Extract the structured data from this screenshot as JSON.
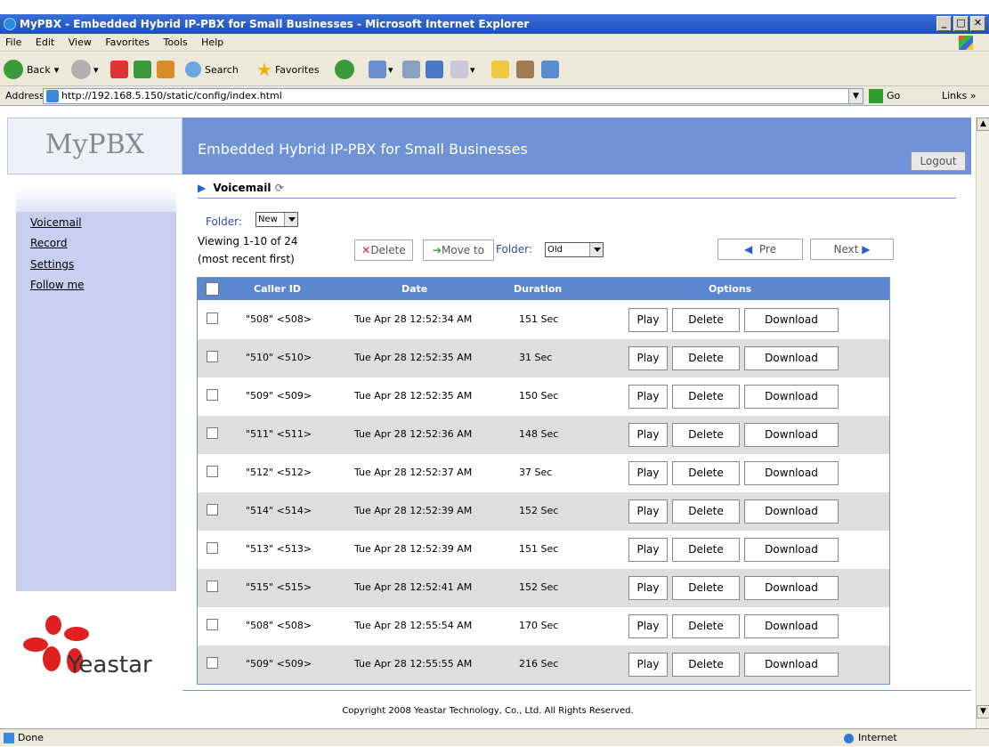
{
  "window": {
    "title": "MyPBX - Embedded Hybrid IP-PBX for Small Businesses - Microsoft Internet Explorer"
  },
  "menu": [
    "File",
    "Edit",
    "View",
    "Favorites",
    "Tools",
    "Help"
  ],
  "toolbar": {
    "back": "Back",
    "search": "Search",
    "favorites": "Favorites"
  },
  "address": {
    "label": "Address",
    "url": "http://192.168.5.150/static/config/index.html",
    "go": "Go",
    "links": "Links"
  },
  "header": {
    "logo": "MyPBX",
    "title": "Embedded Hybrid IP-PBX for Small Businesses",
    "logout": "Logout"
  },
  "sidebar": {
    "items": [
      "Voicemail",
      "Record",
      "Settings",
      "Follow me"
    ],
    "brand": "Yeastar"
  },
  "page": {
    "breadcrumb": "Voicemail",
    "folder_label": "Folder:",
    "folder_value": "New",
    "viewing": "Viewing 1-10 of 24",
    "order": "(most recent first)",
    "delete_btn": "Delete",
    "move_btn": "Move to",
    "move_folder_label": "Folder:",
    "move_folder_value": "Old",
    "pre": "Pre",
    "next": "Next"
  },
  "table": {
    "headers": [
      "Caller ID",
      "Date",
      "Duration",
      "Options"
    ],
    "option_labels": [
      "Play",
      "Delete",
      "Download"
    ],
    "rows": [
      {
        "caller": "\"508\" <508>",
        "date": "Tue Apr 28 12:52:34 AM",
        "duration": "151 Sec"
      },
      {
        "caller": "\"510\" <510>",
        "date": "Tue Apr 28 12:52:35 AM",
        "duration": "31 Sec"
      },
      {
        "caller": "\"509\" <509>",
        "date": "Tue Apr 28 12:52:35 AM",
        "duration": "150 Sec"
      },
      {
        "caller": "\"511\" <511>",
        "date": "Tue Apr 28 12:52:36 AM",
        "duration": "148 Sec"
      },
      {
        "caller": "\"512\" <512>",
        "date": "Tue Apr 28 12:52:37 AM",
        "duration": "37 Sec"
      },
      {
        "caller": "\"514\" <514>",
        "date": "Tue Apr 28 12:52:39 AM",
        "duration": "152 Sec"
      },
      {
        "caller": "\"513\" <513>",
        "date": "Tue Apr 28 12:52:39 AM",
        "duration": "151 Sec"
      },
      {
        "caller": "\"515\" <515>",
        "date": "Tue Apr 28 12:52:41 AM",
        "duration": "152 Sec"
      },
      {
        "caller": "\"508\" <508>",
        "date": "Tue Apr 28 12:55:54 AM",
        "duration": "170 Sec"
      },
      {
        "caller": "\"509\" <509>",
        "date": "Tue Apr 28 12:55:55 AM",
        "duration": "216 Sec"
      }
    ]
  },
  "footer": {
    "copyright": "Copyright 2008 Yeastar Technology, Co., Ltd. All Rights Reserved."
  },
  "status": {
    "left": "Done",
    "zone": "Internet"
  },
  "colors": {
    "header": "#6f93d6",
    "table_header": "#5b87cf",
    "sidebar": "#c7d0f0",
    "alt_row": "#dedede"
  }
}
